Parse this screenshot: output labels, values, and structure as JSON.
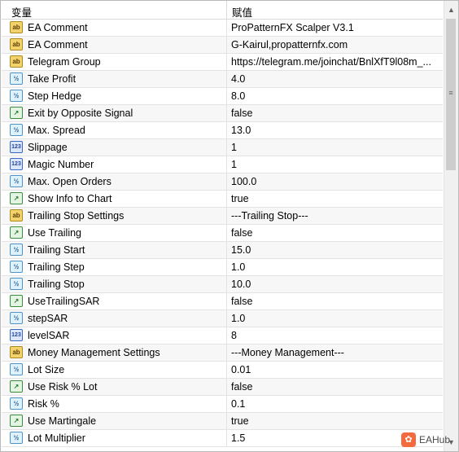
{
  "header": {
    "col1": "变量",
    "col2": "赋值"
  },
  "rows": [
    {
      "icon": "ab",
      "name": "EA Comment",
      "value": "ProPatternFX Scalper V3.1"
    },
    {
      "icon": "ab",
      "name": "EA Comment",
      "value": "G-Kairul,propatternfx.com"
    },
    {
      "icon": "ab",
      "name": "Telegram Group",
      "value": "https://telegram.me/joinchat/BnlXfT9l08m_..."
    },
    {
      "icon": "v2",
      "name": "Take Profit",
      "value": "4.0"
    },
    {
      "icon": "v2",
      "name": "Step Hedge",
      "value": "8.0"
    },
    {
      "icon": "bool",
      "name": "Exit by Opposite Signal",
      "value": "false"
    },
    {
      "icon": "v2",
      "name": "Max. Spread",
      "value": "13.0"
    },
    {
      "icon": "int",
      "name": "Slippage",
      "value": "1"
    },
    {
      "icon": "int",
      "name": "Magic Number",
      "value": "1"
    },
    {
      "icon": "v2",
      "name": "Max. Open Orders",
      "value": "100.0"
    },
    {
      "icon": "bool",
      "name": "Show Info to Chart",
      "value": "true"
    },
    {
      "icon": "ab",
      "name": "Trailing Stop Settings",
      "value": "---Trailing Stop---"
    },
    {
      "icon": "bool",
      "name": "Use Trailing",
      "value": "false"
    },
    {
      "icon": "v2",
      "name": "Trailing Start",
      "value": "15.0"
    },
    {
      "icon": "v2",
      "name": "Trailing Step",
      "value": "1.0"
    },
    {
      "icon": "v2",
      "name": "Trailing Stop",
      "value": "10.0"
    },
    {
      "icon": "bool",
      "name": "UseTrailingSAR",
      "value": "false"
    },
    {
      "icon": "v2",
      "name": "stepSAR",
      "value": "1.0"
    },
    {
      "icon": "int",
      "name": "levelSAR",
      "value": "8"
    },
    {
      "icon": "ab",
      "name": "Money Management Settings",
      "value": "---Money Management---"
    },
    {
      "icon": "v2",
      "name": "Lot Size",
      "value": "0.01"
    },
    {
      "icon": "bool",
      "name": "Use Risk % Lot",
      "value": "false"
    },
    {
      "icon": "v2",
      "name": "Risk %",
      "value": "0.1"
    },
    {
      "icon": "bool",
      "name": "Use Martingale",
      "value": "true"
    },
    {
      "icon": "v2",
      "name": "Lot Multiplier",
      "value": "1.5"
    }
  ],
  "icons": {
    "ab": {
      "glyph": "ab",
      "meaning": "string-type-icon"
    },
    "v2": {
      "glyph": "½",
      "meaning": "double-type-icon"
    },
    "bool": {
      "glyph": "↗",
      "meaning": "bool-type-icon"
    },
    "int": {
      "glyph": "123",
      "meaning": "integer-type-icon"
    }
  },
  "scrollbar": {
    "up": "▲",
    "down": "▼",
    "grip": "≡"
  },
  "watermark": {
    "logo": "✿",
    "text": "EAHub"
  }
}
